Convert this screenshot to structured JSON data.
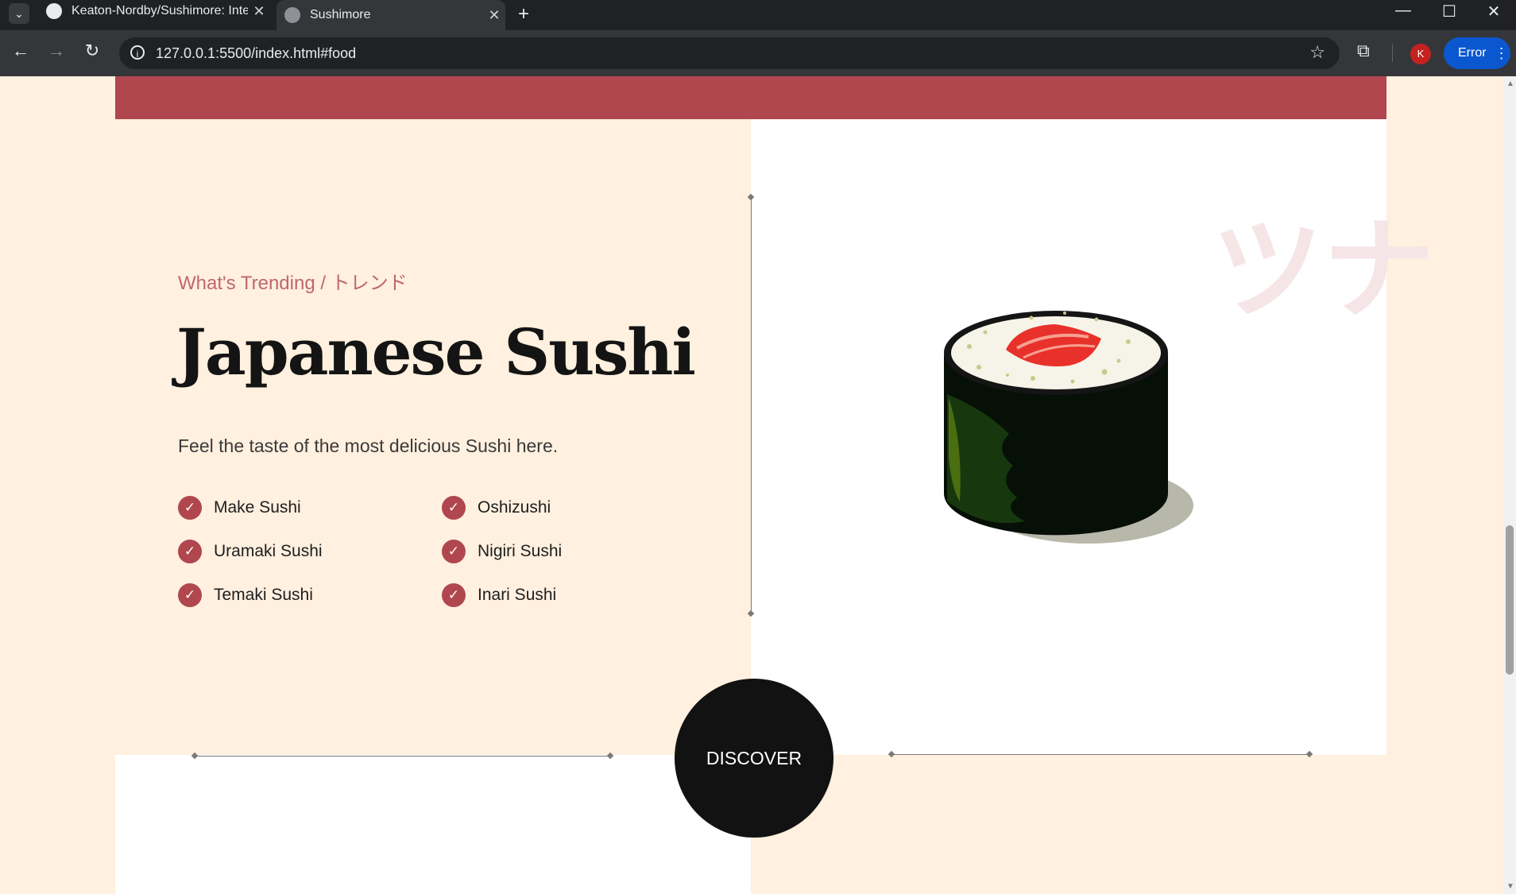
{
  "browser": {
    "tabs": [
      {
        "title": "Keaton-Nordby/Sushimore: Inte",
        "icon": "github-icon"
      },
      {
        "title": "Sushimore",
        "icon": "globe-icon",
        "active": true
      }
    ],
    "url": "127.0.0.1:5500/index.html#food",
    "profile_initial": "K",
    "error_label": "Error"
  },
  "section": {
    "eyebrow": "What's Trending / トレンド",
    "title": "Japanese Sushi",
    "description": "Feel the taste of the most delicious Sushi here.",
    "items": [
      "Make Sushi",
      "Oshizushi",
      "Uramaki Sushi",
      "Nigiri Sushi",
      "Temaki Sushi",
      "Inari Sushi"
    ],
    "kana": "ツナ",
    "discover_label": "DISCOVER"
  },
  "colors": {
    "accent": "#b0474f",
    "background": "#fff0df",
    "dark": "#121212"
  }
}
